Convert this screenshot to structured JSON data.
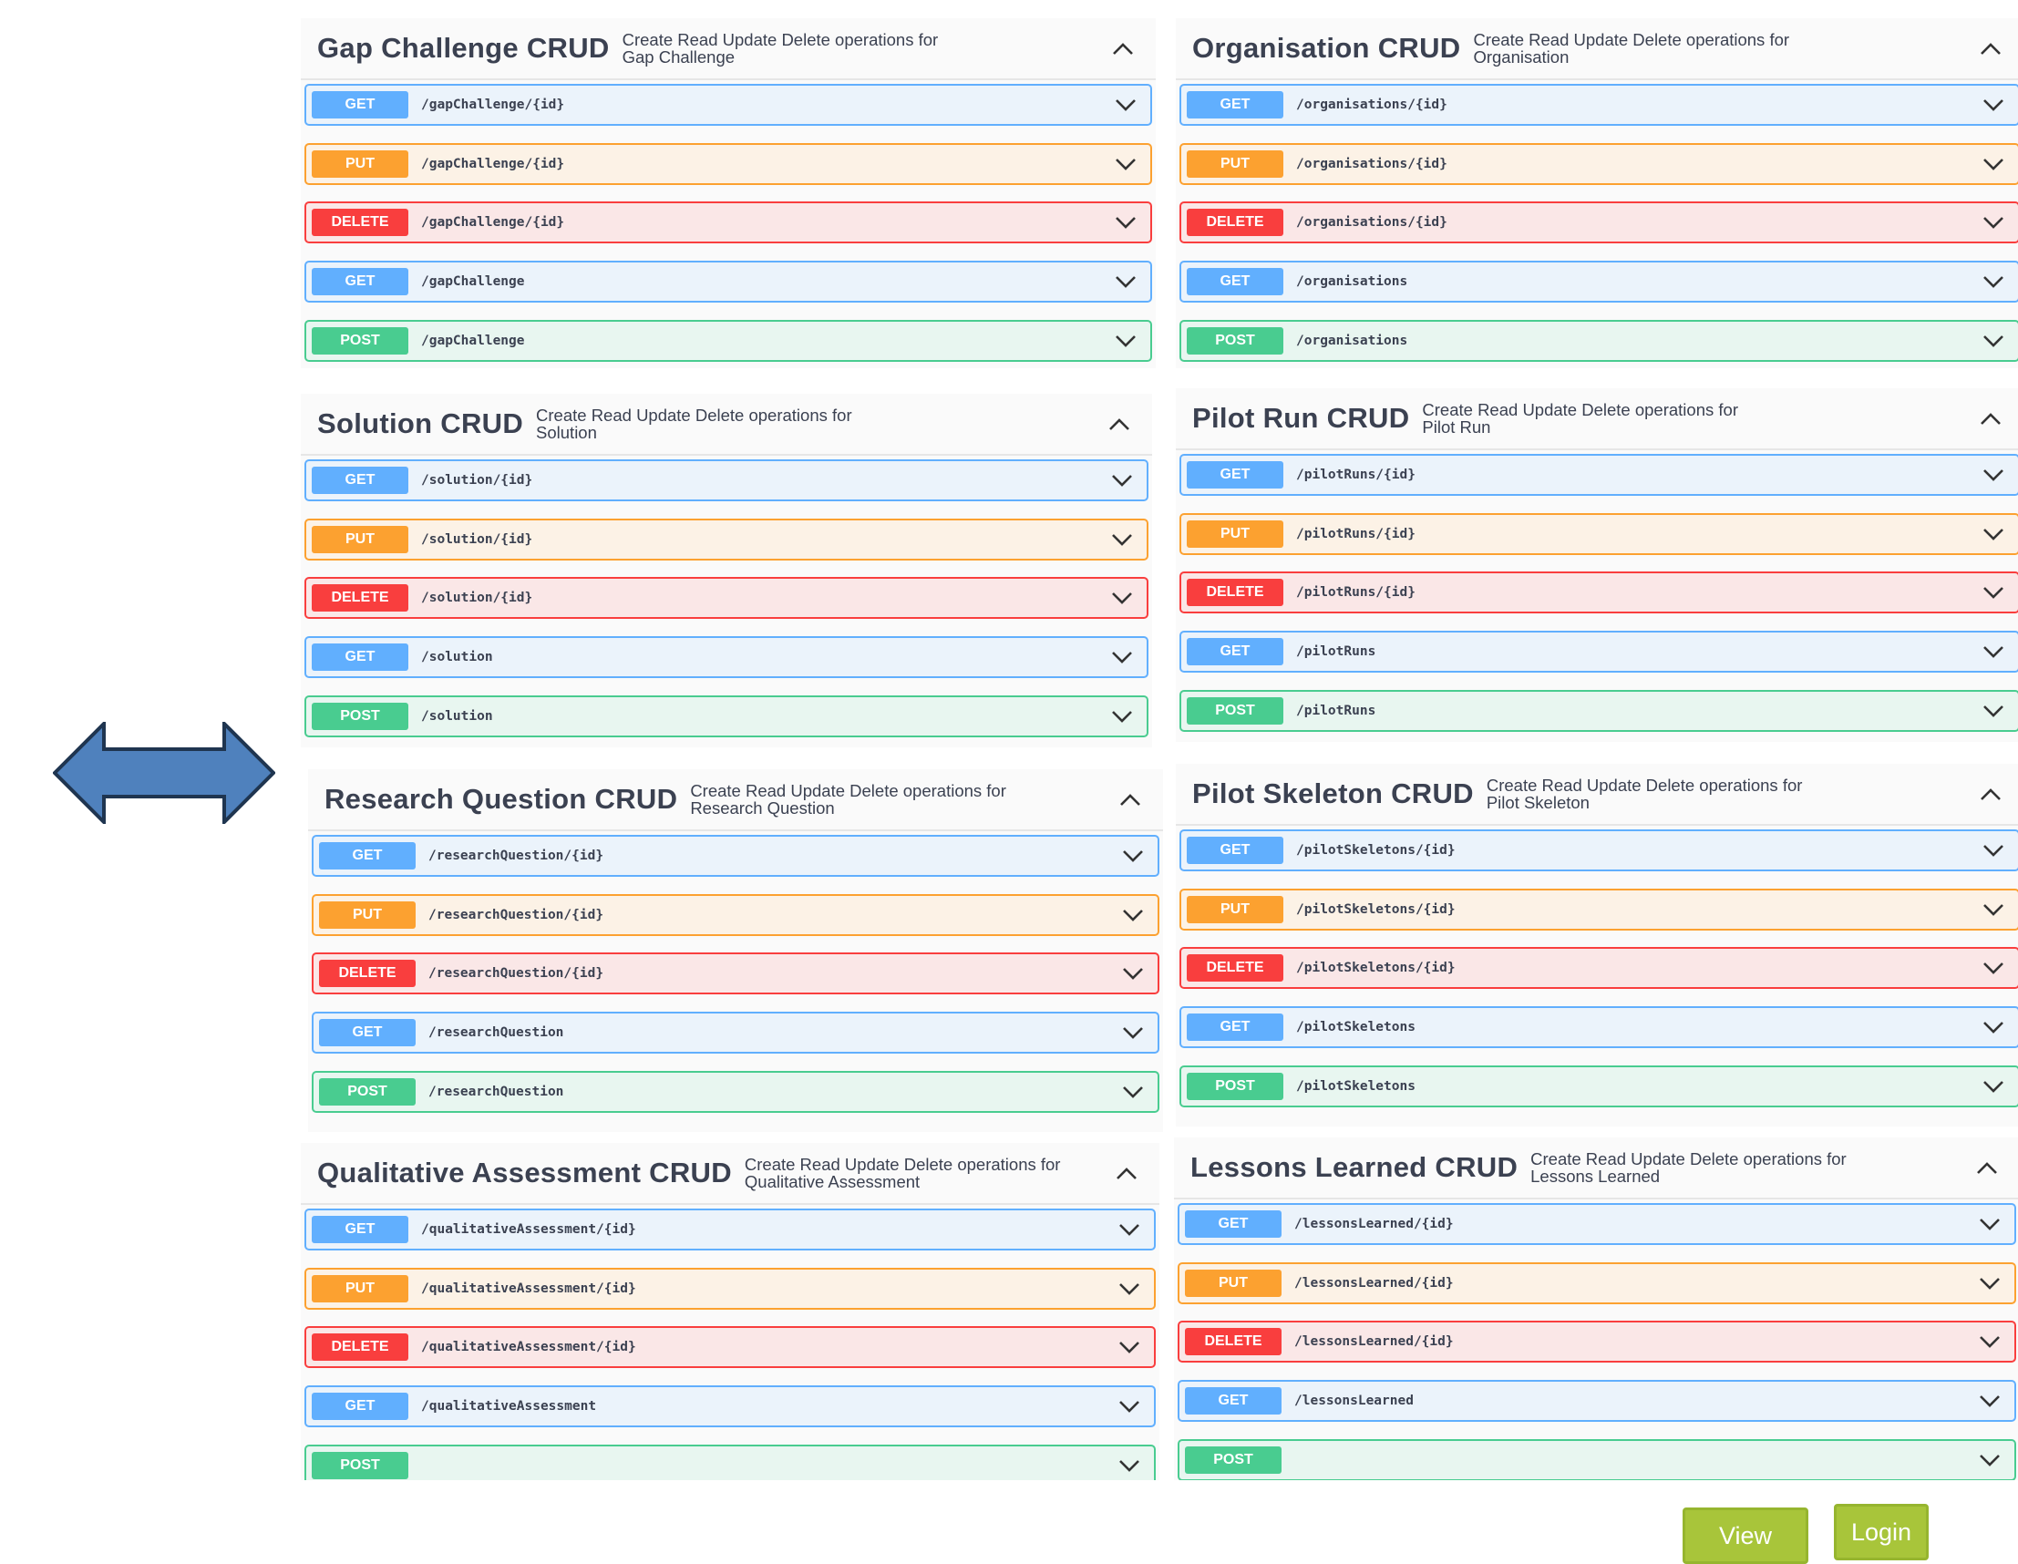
{
  "icons": {
    "arrow": "double-headed-arrow",
    "collapse": "chevron-up-icon",
    "expand": "chevron-down-icon"
  },
  "colors": {
    "get": "#61affe",
    "put": "#fca130",
    "delete": "#f93e3e",
    "post": "#49cc90",
    "button": "#a8c53a",
    "arrow": "#4f81bd"
  },
  "sections": [
    {
      "id": "gap-challenge",
      "title": "Gap Challenge CRUD",
      "description": "Create Read Update Delete operations for Gap Challenge",
      "operations": [
        {
          "method": "GET",
          "path": "/gapChallenge/{id}"
        },
        {
          "method": "PUT",
          "path": "/gapChallenge/{id}"
        },
        {
          "method": "DELETE",
          "path": "/gapChallenge/{id}"
        },
        {
          "method": "GET",
          "path": "/gapChallenge"
        },
        {
          "method": "POST",
          "path": "/gapChallenge"
        }
      ]
    },
    {
      "id": "organisation",
      "title": "Organisation CRUD",
      "description": "Create Read Update Delete operations for Organisation",
      "operations": [
        {
          "method": "GET",
          "path": "/organisations/{id}"
        },
        {
          "method": "PUT",
          "path": "/organisations/{id}"
        },
        {
          "method": "DELETE",
          "path": "/organisations/{id}"
        },
        {
          "method": "GET",
          "path": "/organisations"
        },
        {
          "method": "POST",
          "path": "/organisations"
        }
      ]
    },
    {
      "id": "solution",
      "title": "Solution CRUD",
      "description": "Create Read Update Delete operations for Solution",
      "operations": [
        {
          "method": "GET",
          "path": "/solution/{id}"
        },
        {
          "method": "PUT",
          "path": "/solution/{id}"
        },
        {
          "method": "DELETE",
          "path": "/solution/{id}"
        },
        {
          "method": "GET",
          "path": "/solution"
        },
        {
          "method": "POST",
          "path": "/solution"
        }
      ]
    },
    {
      "id": "pilot-run",
      "title": "Pilot Run CRUD",
      "description": "Create Read Update Delete operations for Pilot Run",
      "operations": [
        {
          "method": "GET",
          "path": "/pilotRuns/{id}"
        },
        {
          "method": "PUT",
          "path": "/pilotRuns/{id}"
        },
        {
          "method": "DELETE",
          "path": "/pilotRuns/{id}"
        },
        {
          "method": "GET",
          "path": "/pilotRuns"
        },
        {
          "method": "POST",
          "path": "/pilotRuns"
        }
      ]
    },
    {
      "id": "research-question",
      "title": "Research Question CRUD",
      "description": "Create Read Update Delete operations for Research Question",
      "operations": [
        {
          "method": "GET",
          "path": "/researchQuestion/{id}"
        },
        {
          "method": "PUT",
          "path": "/researchQuestion/{id}"
        },
        {
          "method": "DELETE",
          "path": "/researchQuestion/{id}"
        },
        {
          "method": "GET",
          "path": "/researchQuestion"
        },
        {
          "method": "POST",
          "path": "/researchQuestion"
        }
      ]
    },
    {
      "id": "pilot-skeleton",
      "title": "Pilot Skeleton CRUD",
      "description": "Create Read Update Delete operations for Pilot Skeleton",
      "operations": [
        {
          "method": "GET",
          "path": "/pilotSkeletons/{id}"
        },
        {
          "method": "PUT",
          "path": "/pilotSkeletons/{id}"
        },
        {
          "method": "DELETE",
          "path": "/pilotSkeletons/{id}"
        },
        {
          "method": "GET",
          "path": "/pilotSkeletons"
        },
        {
          "method": "POST",
          "path": "/pilotSkeletons"
        }
      ]
    },
    {
      "id": "qualitative-assessment",
      "title": "Qualitative Assessment CRUD",
      "description": "Create Read Update Delete operations for Qualitative Assessment",
      "operations": [
        {
          "method": "GET",
          "path": "/qualitativeAssessment/{id}"
        },
        {
          "method": "PUT",
          "path": "/qualitativeAssessment/{id}"
        },
        {
          "method": "DELETE",
          "path": "/qualitativeAssessment/{id}"
        },
        {
          "method": "GET",
          "path": "/qualitativeAssessment"
        },
        {
          "method": "POST",
          "path": ""
        }
      ]
    },
    {
      "id": "lessons-learned",
      "title": "Lessons Learned CRUD",
      "description": "Create Read Update Delete operations for Lessons Learned",
      "operations": [
        {
          "method": "GET",
          "path": "/lessonsLearned/{id}"
        },
        {
          "method": "PUT",
          "path": "/lessonsLearned/{id}"
        },
        {
          "method": "DELETE",
          "path": "/lessonsLearned/{id}"
        },
        {
          "method": "GET",
          "path": "/lessonsLearned"
        },
        {
          "method": "POST",
          "path": ""
        }
      ]
    }
  ],
  "buttons": {
    "view": "View",
    "login": "Login"
  }
}
